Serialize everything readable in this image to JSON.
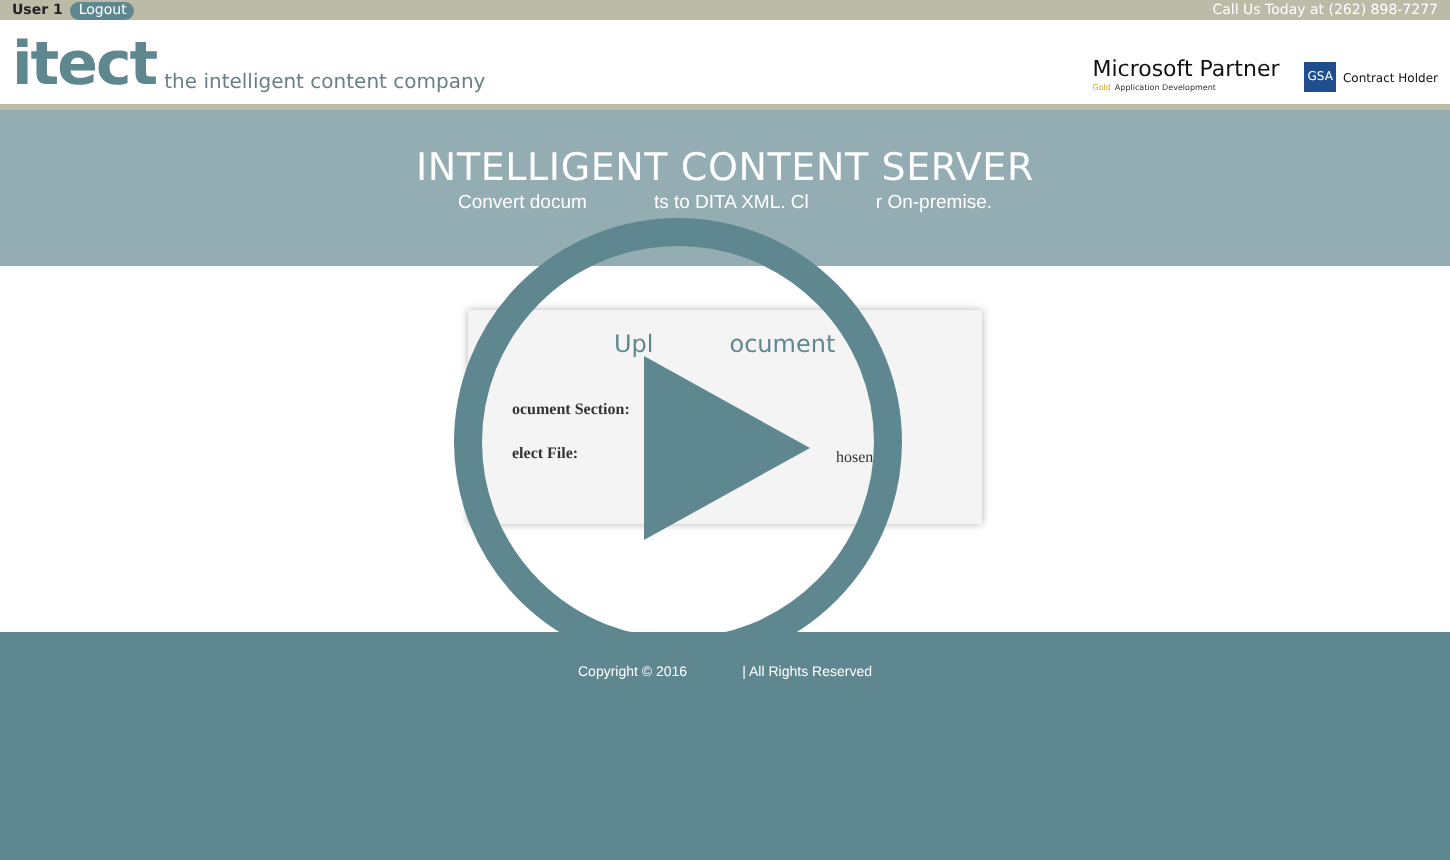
{
  "top_bar": {
    "user": "User 1",
    "logout": "Logout",
    "phone": "Call Us Today at (262) 898-7277"
  },
  "header": {
    "logo": "itect",
    "tagline": "the intelligent content company",
    "partner": {
      "title": "Microsoft Partner",
      "level": "Gold",
      "area": "Application Development"
    },
    "gsa": {
      "badge": "GSA",
      "text": "Contract Holder"
    }
  },
  "hero": {
    "title": "INTELLIGENT CONTENT SERVER",
    "subtitle_parts": [
      "Convert docum",
      "ts to DITA XML. Cl",
      "r On-premise."
    ]
  },
  "card": {
    "title_parts": [
      "Upl",
      "ocument"
    ],
    "fields": [
      {
        "label": "ocument Section:"
      },
      {
        "label": "elect File:",
        "value": "hosen"
      }
    ]
  },
  "footer": {
    "parts": [
      "Copyright © 2016",
      "| All Rights Reserved"
    ]
  },
  "overlay": {
    "kind": "play"
  }
}
